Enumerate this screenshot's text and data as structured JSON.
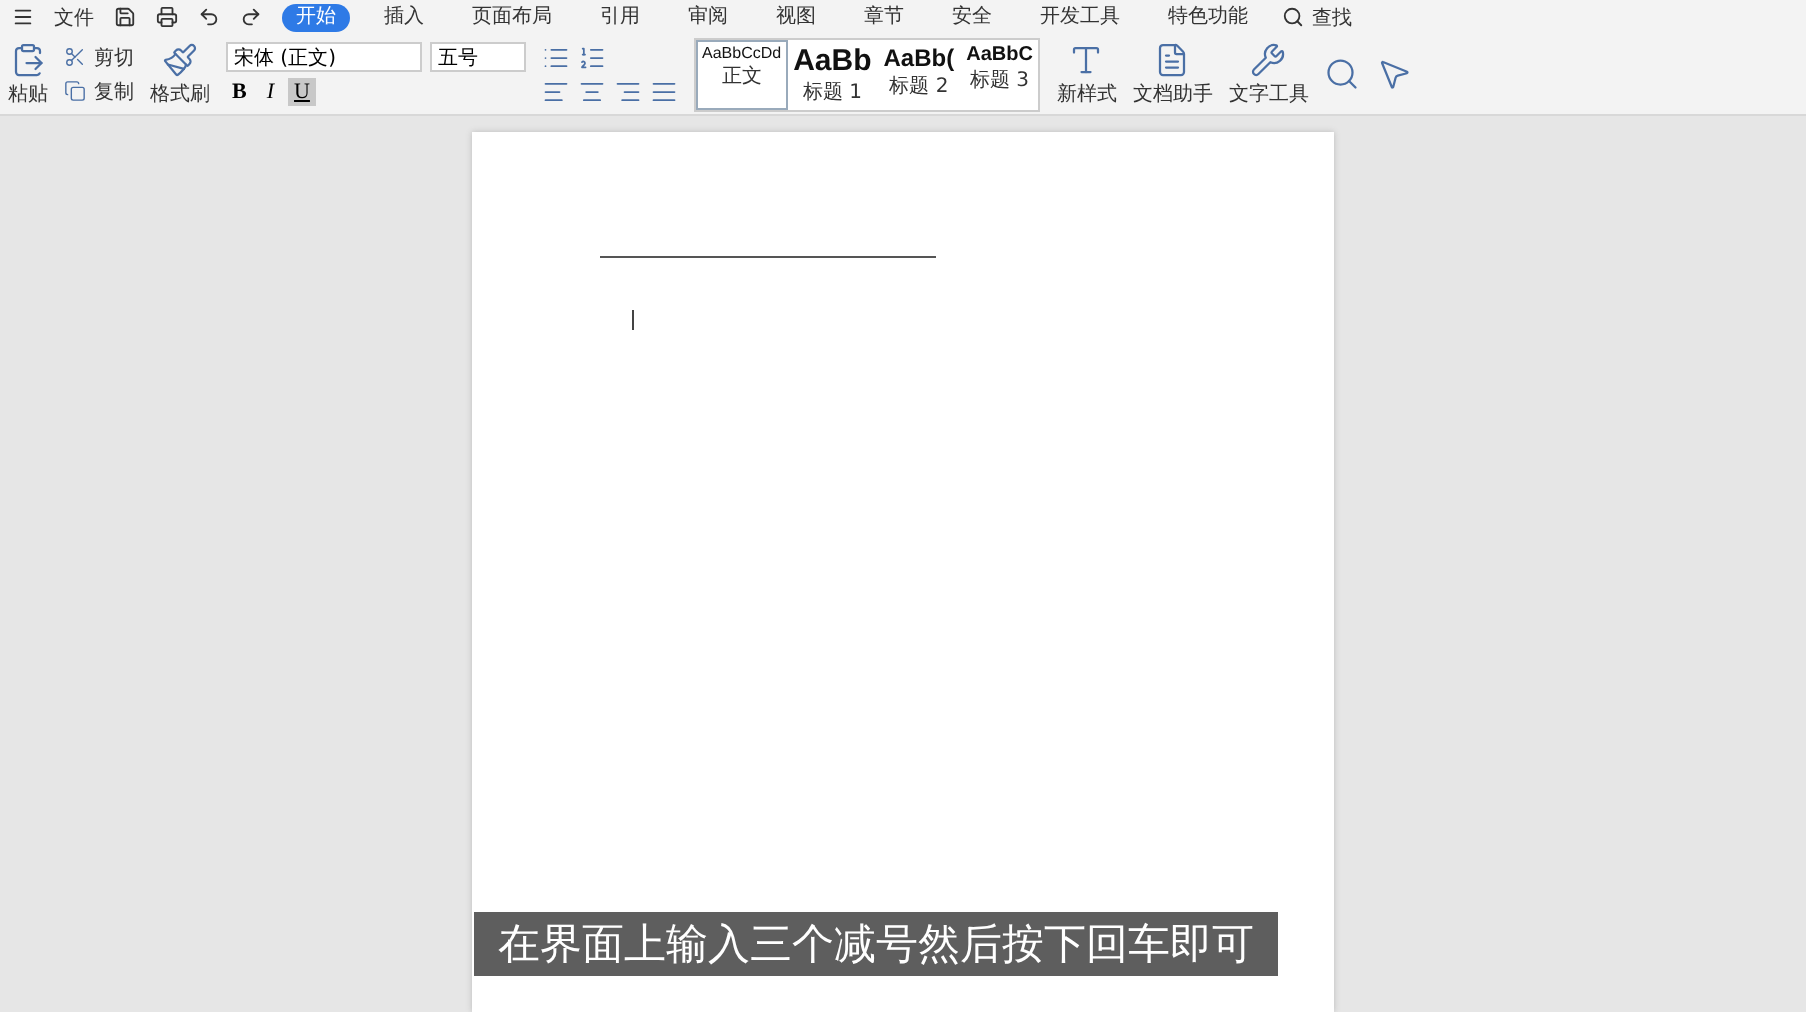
{
  "menu_bar": {
    "file_menu": "文件",
    "tabs": [
      {
        "label": "开始",
        "selected": true
      },
      {
        "label": "插入",
        "selected": false
      },
      {
        "label": "页面布局",
        "selected": false
      },
      {
        "label": "引用",
        "selected": false
      },
      {
        "label": "审阅",
        "selected": false
      },
      {
        "label": "视图",
        "selected": false
      },
      {
        "label": "章节",
        "selected": false
      },
      {
        "label": "安全",
        "selected": false
      },
      {
        "label": "开发工具",
        "selected": false
      },
      {
        "label": "特色功能",
        "selected": false
      }
    ],
    "search": "查找"
  },
  "ribbon": {
    "clipboard": {
      "paste": "粘贴",
      "cut": "剪切",
      "copy": "复制",
      "format_painter": "格式刷"
    },
    "font": {
      "font_name": "宋体 (正文)",
      "font_size": "五号",
      "format_buttons": [
        {
          "label": "B",
          "kind": "bold",
          "selected": false
        },
        {
          "label": "I",
          "kind": "italic",
          "selected": false
        },
        {
          "label": "U",
          "kind": "underline",
          "selected": true
        }
      ]
    },
    "styles": [
      {
        "sample": "AaBbCcDd",
        "label": "正文",
        "kind": "normal",
        "selected": true
      },
      {
        "sample": "AaBb",
        "label": "标题 1",
        "kind": "heading1",
        "selected": false
      },
      {
        "sample": "AaBb(",
        "label": "标题 2",
        "kind": "heading2",
        "selected": false
      },
      {
        "sample": "AaBbC",
        "label": "标题 3",
        "kind": "heading3",
        "selected": false
      }
    ],
    "tools": [
      {
        "label": "新样式",
        "kind": "style"
      },
      {
        "label": "文档助手",
        "kind": "doc"
      },
      {
        "label": "文字工具",
        "kind": "wrench"
      }
    ]
  },
  "caption": "在界面上输入三个减号然后按下回车即可"
}
